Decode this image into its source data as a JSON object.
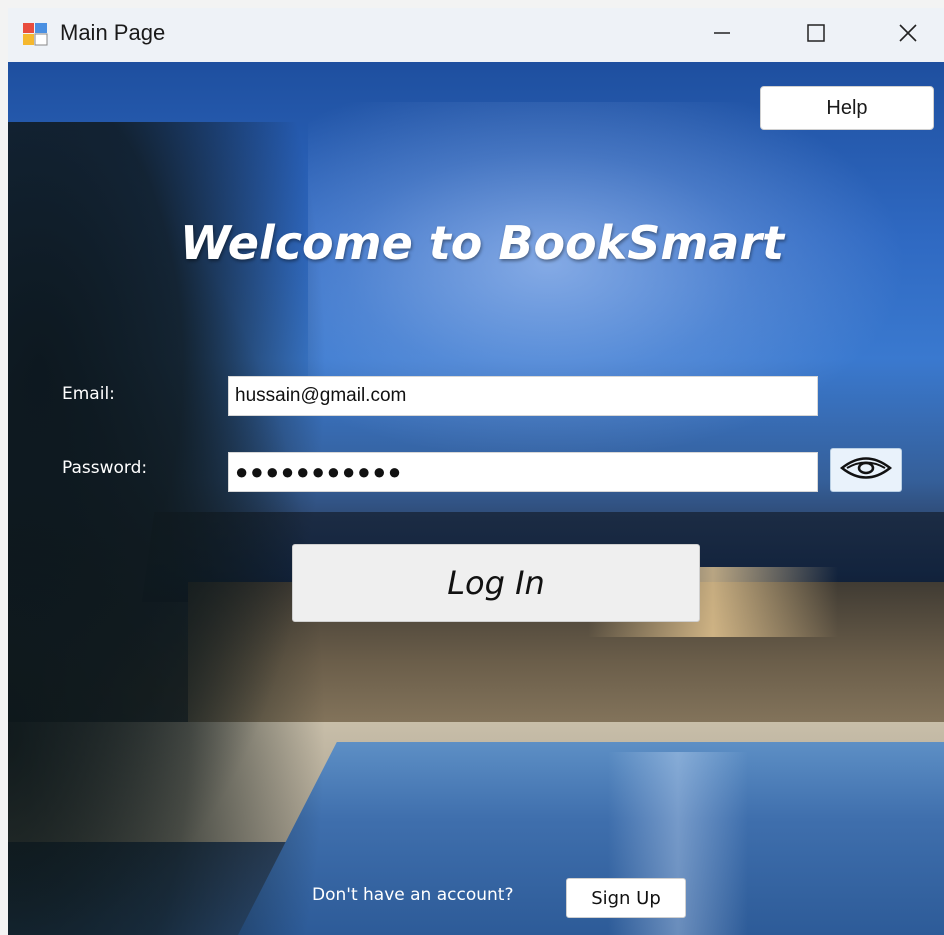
{
  "window": {
    "title": "Main Page",
    "icons": {
      "app": "app-icon",
      "minimize": "minimize-icon",
      "maximize": "maximize-icon",
      "close": "close-icon"
    }
  },
  "header": {
    "help_label": "Help"
  },
  "main": {
    "welcome": "Welcome to BookSmart",
    "email_label": "Email:",
    "email_value": "hussain@gmail.com",
    "password_label": "Password:",
    "password_value": "●●●●●●●●●●●",
    "show_password_icon": "eye-icon",
    "login_label": "Log In",
    "signup_prompt": "Don't have an account?",
    "signup_label": "Sign Up"
  },
  "colors": {
    "input_bg": "#ffffff",
    "button_bg": "#efefef",
    "eye_button_bg": "#e9f2fb",
    "text_on_background": "#ffffff"
  }
}
